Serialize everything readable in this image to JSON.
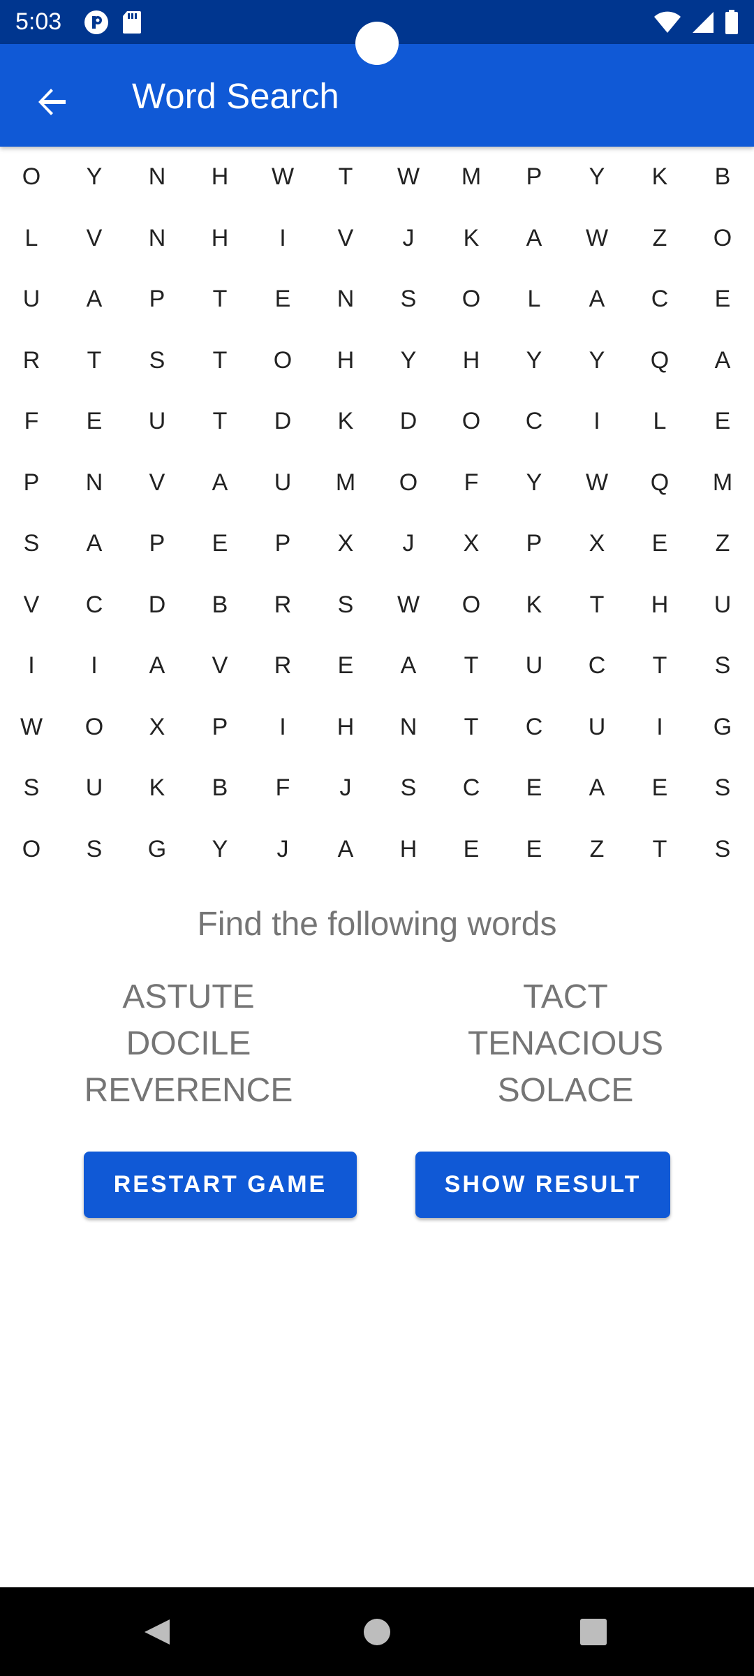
{
  "status_bar": {
    "time": "5:03",
    "left_icons": [
      "p-icon",
      "sd-card-icon"
    ],
    "right_icons": [
      "wifi-icon",
      "signal-icon",
      "battery-icon"
    ]
  },
  "app_bar": {
    "title": "Word Search",
    "back_icon": "arrow-back-icon"
  },
  "grid": {
    "rows": [
      [
        "O",
        "Y",
        "N",
        "H",
        "W",
        "T",
        "W",
        "M",
        "P",
        "Y",
        "K",
        "B"
      ],
      [
        "L",
        "V",
        "N",
        "H",
        "I",
        "V",
        "J",
        "K",
        "A",
        "W",
        "Z",
        "O"
      ],
      [
        "U",
        "A",
        "P",
        "T",
        "E",
        "N",
        "S",
        "O",
        "L",
        "A",
        "C",
        "E"
      ],
      [
        "R",
        "T",
        "S",
        "T",
        "O",
        "H",
        "Y",
        "H",
        "Y",
        "Y",
        "Q",
        "A"
      ],
      [
        "F",
        "E",
        "U",
        "T",
        "D",
        "K",
        "D",
        "O",
        "C",
        "I",
        "L",
        "E"
      ],
      [
        "P",
        "N",
        "V",
        "A",
        "U",
        "M",
        "O",
        "F",
        "Y",
        "W",
        "Q",
        "M"
      ],
      [
        "S",
        "A",
        "P",
        "E",
        "P",
        "X",
        "J",
        "X",
        "P",
        "X",
        "E",
        "Z"
      ],
      [
        "V",
        "C",
        "D",
        "B",
        "R",
        "S",
        "W",
        "O",
        "K",
        "T",
        "H",
        "U"
      ],
      [
        "I",
        "I",
        "A",
        "V",
        "R",
        "E",
        "A",
        "T",
        "U",
        "C",
        "T",
        "S"
      ],
      [
        "W",
        "O",
        "X",
        "P",
        "I",
        "H",
        "N",
        "T",
        "C",
        "U",
        "I",
        "G"
      ],
      [
        "S",
        "U",
        "K",
        "B",
        "F",
        "J",
        "S",
        "C",
        "E",
        "A",
        "E",
        "S"
      ],
      [
        "O",
        "S",
        "G",
        "Y",
        "J",
        "A",
        "H",
        "E",
        "E",
        "Z",
        "T",
        "S"
      ]
    ]
  },
  "instructions": "Find the following words",
  "words": {
    "left": [
      "ASTUTE",
      "DOCILE",
      "REVERENCE"
    ],
    "right": [
      "TACT",
      "TENACIOUS",
      "SOLACE"
    ]
  },
  "buttons": {
    "restart_label": "RESTART GAME",
    "show_result_label": "SHOW RESULT"
  },
  "colors": {
    "status_bar": "#00368f",
    "app_bar": "#1059d6",
    "button": "#1059d6",
    "text_secondary": "#757575"
  },
  "nav_bar": {
    "icons": [
      "nav-back-icon",
      "nav-home-icon",
      "nav-recents-icon"
    ]
  }
}
